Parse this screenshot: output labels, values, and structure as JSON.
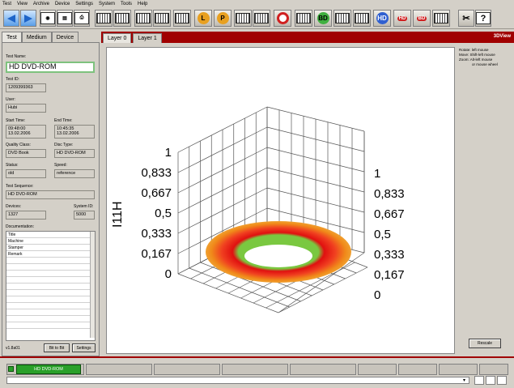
{
  "menu": [
    "Test",
    "View",
    "Archive",
    "Device",
    "Settings",
    "System",
    "Tools",
    "Help"
  ],
  "left": {
    "tabs": [
      "Test",
      "Medium",
      "Device"
    ],
    "fields": {
      "test_name_label": "Test Name:",
      "test_name": "HD DVD-ROM",
      "test_id_label": "Test ID:",
      "test_id": "1209399363",
      "user_label": "User:",
      "user": "Hubi",
      "start_label": "Start Time:",
      "start": "09:48:00\n13.02.2006",
      "end_label": "End Time:",
      "end": "10:45:35\n13.02.2006",
      "quality_label": "Quality Class:",
      "quality": "DVD Book",
      "disc_label": "Disc Type:",
      "disc": "HD DVD-ROM",
      "status_label": "Status:",
      "status": "old",
      "speed_label": "Speed:",
      "speed": "reference",
      "sequence_label": "Test Sequence:",
      "sequence": "HD DVD-ROM",
      "devices_label": "Devices:",
      "devices": "1327",
      "system_label": "System ID:",
      "system": "5000",
      "doc_label": "Documentation:"
    },
    "doc_rows": [
      "Title",
      "Machine",
      "Stamper",
      "Remark"
    ],
    "version": "v1.8a01",
    "bit_btn": "Bit to Bit",
    "settings_btn": "Settings"
  },
  "right": {
    "tabs": [
      "Layer 0",
      "Layer 1"
    ],
    "view_tag": "3DView",
    "help": [
      "Rotate: left mouse",
      "Move:  Shift-left mouse",
      "Zoom:  Alt-left mouse",
      "or mouse wheel"
    ],
    "rescale": "Rescale"
  },
  "chart_data": {
    "type": "surface3d",
    "z_label": "I11H",
    "left_ticks": [
      "1",
      "0,833",
      "0,667",
      "0,5",
      "0,333",
      "0,167",
      "0"
    ],
    "right_ticks": [
      "1",
      "0,833",
      "0,667",
      "0,5",
      "0,333",
      "0,167",
      "0"
    ],
    "colors": {
      "outer": "#f08a1a",
      "inner": "#e01010",
      "edge": "#7ac840",
      "grid": "#555555"
    }
  },
  "statusbar": {
    "active_tab": "HD DVD-ROM"
  },
  "toolbar": {
    "labels": [
      "L",
      "P",
      "BD",
      "HD",
      "HD",
      "BD"
    ]
  }
}
